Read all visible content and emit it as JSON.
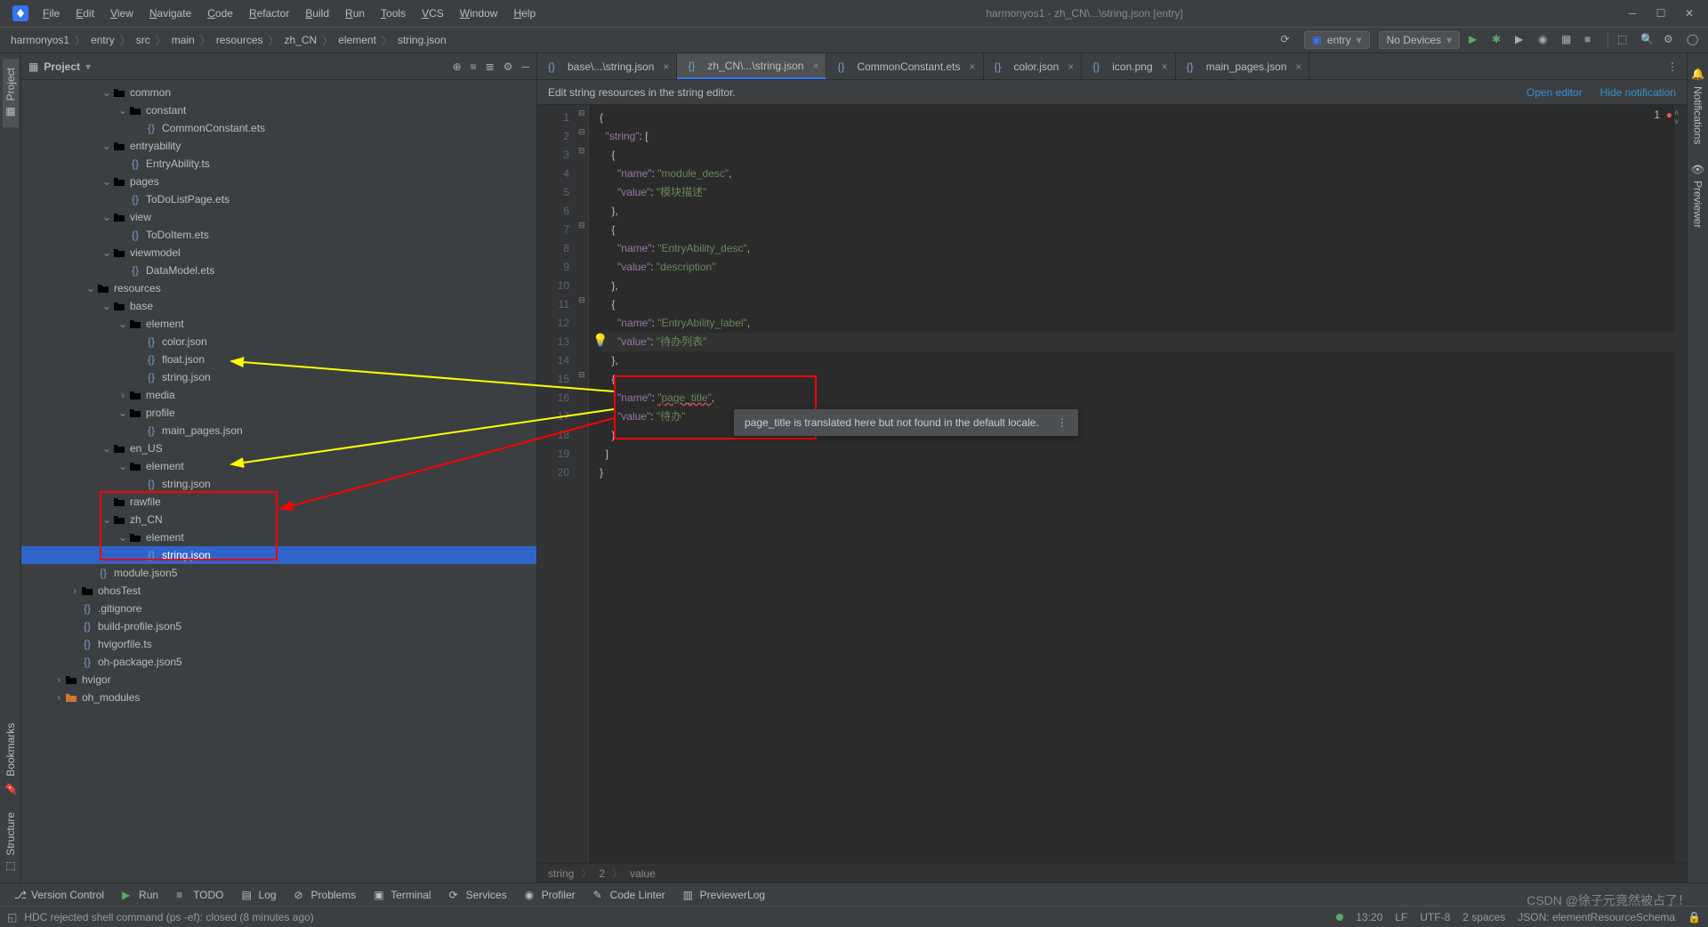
{
  "window": {
    "title": "harmonyos1 - zh_CN\\...\\string.json [entry]"
  },
  "menu": [
    "File",
    "Edit",
    "View",
    "Navigate",
    "Code",
    "Refactor",
    "Build",
    "Run",
    "Tools",
    "VCS",
    "Window",
    "Help"
  ],
  "breadcrumbs": [
    "harmonyos1",
    "entry",
    "src",
    "main",
    "resources",
    "zh_CN",
    "element",
    "string.json"
  ],
  "run_config": {
    "module": "entry",
    "device": "No Devices"
  },
  "project_panel": {
    "title": "Project"
  },
  "tree": [
    {
      "d": 5,
      "t": "v",
      "i": "fold",
      "n": "common"
    },
    {
      "d": 6,
      "t": "v",
      "i": "fold",
      "n": "constant"
    },
    {
      "d": 7,
      "t": "",
      "i": "ets",
      "n": "CommonConstant.ets"
    },
    {
      "d": 5,
      "t": "v",
      "i": "fold",
      "n": "entryability"
    },
    {
      "d": 6,
      "t": "",
      "i": "ts",
      "n": "EntryAbility.ts"
    },
    {
      "d": 5,
      "t": "v",
      "i": "fold",
      "n": "pages"
    },
    {
      "d": 6,
      "t": "",
      "i": "ets",
      "n": "ToDoListPage.ets"
    },
    {
      "d": 5,
      "t": "v",
      "i": "fold",
      "n": "view"
    },
    {
      "d": 6,
      "t": "",
      "i": "ets",
      "n": "ToDoItem.ets"
    },
    {
      "d": 5,
      "t": "v",
      "i": "fold",
      "n": "viewmodel"
    },
    {
      "d": 6,
      "t": "",
      "i": "ets",
      "n": "DataModel.ets"
    },
    {
      "d": 4,
      "t": "v",
      "i": "fold",
      "n": "resources"
    },
    {
      "d": 5,
      "t": "v",
      "i": "fold",
      "n": "base"
    },
    {
      "d": 6,
      "t": "v",
      "i": "fold",
      "n": "element"
    },
    {
      "d": 7,
      "t": "",
      "i": "json",
      "n": "color.json"
    },
    {
      "d": 7,
      "t": "",
      "i": "json",
      "n": "float.json"
    },
    {
      "d": 7,
      "t": "",
      "i": "json",
      "n": "string.json"
    },
    {
      "d": 6,
      "t": ">",
      "i": "fold",
      "n": "media"
    },
    {
      "d": 6,
      "t": "v",
      "i": "fold",
      "n": "profile"
    },
    {
      "d": 7,
      "t": "",
      "i": "json",
      "n": "main_pages.json"
    },
    {
      "d": 5,
      "t": "v",
      "i": "fold",
      "n": "en_US"
    },
    {
      "d": 6,
      "t": "v",
      "i": "fold",
      "n": "element"
    },
    {
      "d": 7,
      "t": "",
      "i": "json",
      "n": "string.json"
    },
    {
      "d": 5,
      "t": "",
      "i": "fold",
      "n": "rawfile"
    },
    {
      "d": 5,
      "t": "v",
      "i": "fold",
      "n": "zh_CN"
    },
    {
      "d": 6,
      "t": "v",
      "i": "fold",
      "n": "element"
    },
    {
      "d": 7,
      "t": "",
      "i": "json",
      "n": "string.json",
      "sel": true
    },
    {
      "d": 4,
      "t": "",
      "i": "json5",
      "n": "module.json5"
    },
    {
      "d": 3,
      "t": ">",
      "i": "fold",
      "n": "ohosTest"
    },
    {
      "d": 3,
      "t": "",
      "i": "git",
      "n": ".gitignore"
    },
    {
      "d": 3,
      "t": "",
      "i": "json5",
      "n": "build-profile.json5"
    },
    {
      "d": 3,
      "t": "",
      "i": "ts",
      "n": "hvigorfile.ts"
    },
    {
      "d": 3,
      "t": "",
      "i": "json5",
      "n": "oh-package.json5"
    },
    {
      "d": 2,
      "t": ">",
      "i": "fold",
      "n": "hvigor"
    },
    {
      "d": 2,
      "t": ">",
      "i": "foldlib",
      "n": "oh_modules"
    }
  ],
  "tabs": [
    {
      "label": "base\\...\\string.json",
      "icon": "json"
    },
    {
      "label": "zh_CN\\...\\string.json",
      "icon": "json",
      "active": true
    },
    {
      "label": "CommonConstant.ets",
      "icon": "ets"
    },
    {
      "label": "color.json",
      "icon": "json"
    },
    {
      "label": "icon.png",
      "icon": "img"
    },
    {
      "label": "main_pages.json",
      "icon": "json"
    }
  ],
  "banner": {
    "text": "Edit string resources in the string editor.",
    "open": "Open editor",
    "hide": "Hide notification"
  },
  "code_lines": [
    "{",
    "  \"string\": [",
    "    {",
    "      \"name\": \"module_desc\",",
    "      \"value\": \"模块描述\"",
    "    },",
    "    {",
    "      \"name\": \"EntryAbility_desc\",",
    "      \"value\": \"description\"",
    "    },",
    "    {",
    "      \"name\": \"EntryAbility_label\",",
    "      \"value\": \"待办列表\"",
    "    },",
    "    {",
    "      \"name\": \"page_title\",",
    "      \"value\": \"待办\"",
    "    }",
    "  ]",
    "}"
  ],
  "error_count": "1",
  "tooltip_text": "page_title is translated here but not found in the default locale.",
  "editor_breadcrumb": [
    "string",
    "2",
    "value"
  ],
  "bottom": [
    "Version Control",
    "Run",
    "TODO",
    "Log",
    "Problems",
    "Terminal",
    "Services",
    "Profiler",
    "Code Linter",
    "PreviewerLog"
  ],
  "status": {
    "msg": "HDC rejected shell command (ps -ef): closed (8 minutes ago)",
    "pos": "13:20",
    "lf": "LF",
    "enc": "UTF-8",
    "indent": "2 spaces",
    "schema": "JSON: elementResourceSchema"
  },
  "side_left": [
    "Project",
    "Bookmarks",
    "Structure"
  ],
  "side_right": [
    "Notifications",
    "Previewer"
  ],
  "watermark": "CSDN @徐子元竟然被占了！"
}
